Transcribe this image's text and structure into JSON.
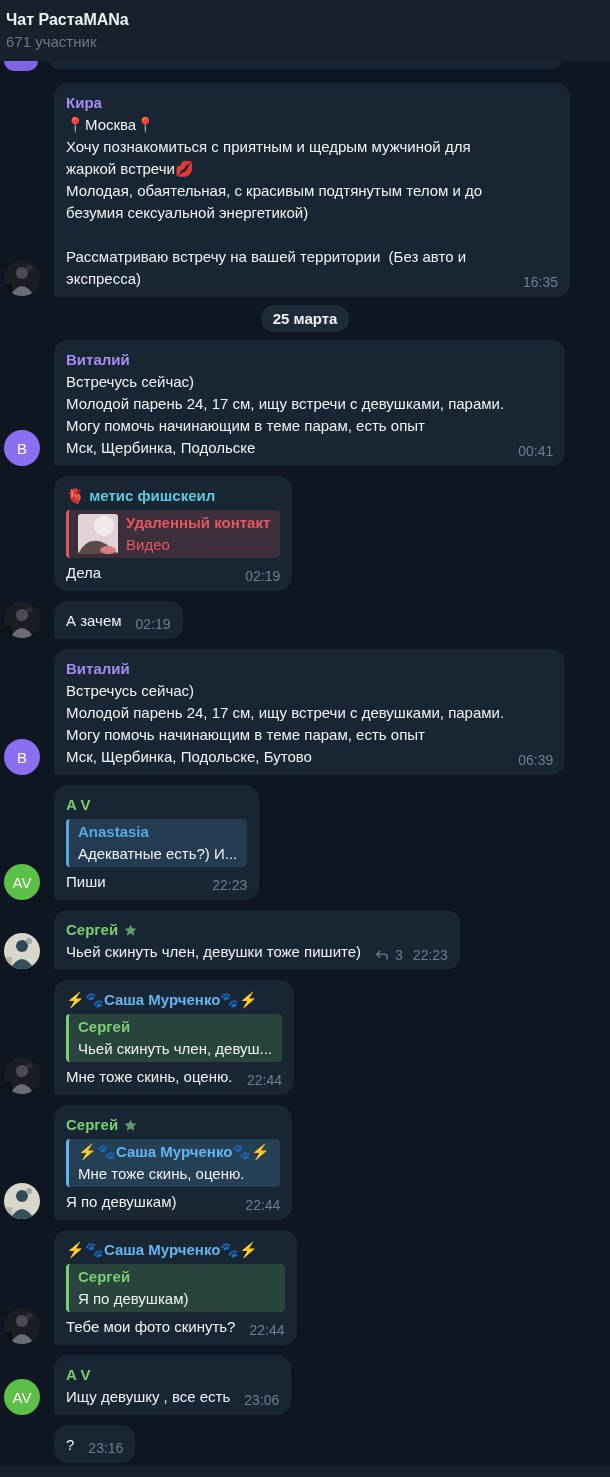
{
  "header": {
    "title": "Чат РастаMANa",
    "subtitle": "671 участник"
  },
  "items": [
    {
      "kind": "message",
      "sender": "Кира",
      "color": "#a48cf0",
      "text": "📍Москва📍\nХочу познакомиться с приятным и щедрым мужчиной для жаркой встречи💋\nМолодая, обаятельная, с красивым подтянутым телом и до безумия сексуальной энергетикой)\n\nРассматриваю встречу на вашей территории  (Без авто и экспресса)",
      "time": "16:35"
    },
    {
      "kind": "date",
      "text": "25 марта"
    },
    {
      "kind": "message",
      "sender": "Виталий",
      "color": "#a48cf0",
      "text": "Встречусь сейчас)\nМолодой парень 24, 17 см, ищу встречи с девушками, парами.\nМогу помочь начинающим в теме парам, есть опыт\nМск, Щербинка, Подольске",
      "time": "00:41",
      "avatar": {
        "kind": "initials",
        "initials": "В",
        "color": "#8b6ff0"
      }
    },
    {
      "kind": "message",
      "sender": "🫀 метис фишскеил",
      "color": "#5fc9d9",
      "reply": {
        "kind": "media",
        "author": "Удаленный контакт",
        "text": "Видео",
        "color": "#e5575f"
      },
      "text": "Дела",
      "time": "02:19"
    },
    {
      "kind": "message",
      "text": "А зачем",
      "time": "02:19"
    },
    {
      "kind": "message",
      "sender": "Виталий",
      "color": "#a48cf0",
      "text": "Встречусь сейчас)\nМолодой парень 24, 17 см, ищу встречи с девушками, парами.\nМогу помочь начинающим в теме парам, есть опыт\nМск, Щербинка, Подольске, Бутово",
      "time": "06:39",
      "avatar": {
        "kind": "initials",
        "initials": "В",
        "color": "#8b6ff0"
      }
    },
    {
      "kind": "message",
      "sender": "A V",
      "color": "#7bcf70",
      "reply": {
        "kind": "text",
        "author": "Anastasia",
        "text": "Адекватные есть?) И...",
        "color": "#5aa8e0"
      },
      "text": "Пиши",
      "time": "22:23",
      "avatar": {
        "kind": "initials",
        "initials": "AV",
        "color": "#5bbf48"
      }
    },
    {
      "kind": "message",
      "sender": "Сергей",
      "color": "#7bcf70",
      "starred": true,
      "text": "Чьей скинуть член, девушки тоже пишите)",
      "replies": "3",
      "time": "22:23"
    },
    {
      "kind": "message",
      "sender": "⚡🐾Саша Мурченко🐾⚡",
      "color": "#64b5ef",
      "reply": {
        "kind": "text",
        "author": "Сергей",
        "text": "Чьей скинуть член, девуш...",
        "color": "#7bcf70"
      },
      "text": "Мне тоже скинь, оценю.",
      "time": "22:44"
    },
    {
      "kind": "message",
      "sender": "Сергей",
      "color": "#7bcf70",
      "starred": true,
      "reply": {
        "kind": "text",
        "author": "⚡🐾Саша Мурченко🐾⚡",
        "text": "Мне тоже скинь, оценю.",
        "color": "#64b5ef"
      },
      "text": "Я по девушкам)",
      "time": "22:44"
    },
    {
      "kind": "message",
      "sender": "⚡🐾Саша Мурченко🐾⚡",
      "color": "#64b5ef",
      "reply": {
        "kind": "text",
        "author": "Сергей",
        "text": "Я по девушкам)",
        "color": "#7bcf70"
      },
      "text": "Тебе мои фото скинуть?",
      "time": "22:44"
    },
    {
      "kind": "message",
      "sender": "A V",
      "color": "#7bcf70",
      "text": "Ищу девушку , все есть",
      "time": "23:06",
      "avatar": {
        "kind": "initials",
        "initials": "AV",
        "color": "#5bbf48"
      }
    },
    {
      "kind": "message",
      "text": "?",
      "time": "23:16"
    }
  ]
}
